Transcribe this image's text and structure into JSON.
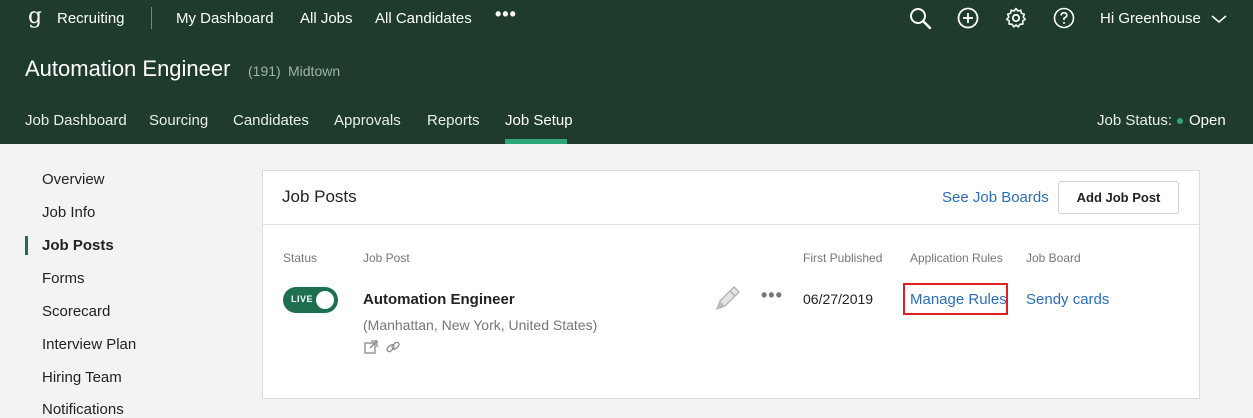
{
  "colors": {
    "header_bg": "#1e3b2c",
    "accent_green": "#2fa67a",
    "link_blue": "#2a6ebb",
    "highlight_red": "#e02020"
  },
  "topnav": {
    "logo_glyph": "g",
    "brand": "Recruiting",
    "links": [
      "My Dashboard",
      "All Jobs",
      "All Candidates"
    ],
    "more_label": "•••",
    "icons": [
      "search-icon",
      "add-circle-icon",
      "gear-icon",
      "help-icon"
    ],
    "user_label": "Hi Greenhouse"
  },
  "job": {
    "title": "Automation Engineer",
    "count": "(191)",
    "location": "Midtown"
  },
  "tabs": [
    "Job Dashboard",
    "Sourcing",
    "Candidates",
    "Approvals",
    "Reports",
    "Job Setup"
  ],
  "active_tab": "Job Setup",
  "job_status": {
    "label": "Job Status:",
    "value": "Open"
  },
  "sidebar": {
    "items": [
      "Overview",
      "Job Info",
      "Job Posts",
      "Forms",
      "Scorecard",
      "Interview Plan",
      "Hiring Team",
      "Notifications"
    ],
    "active": "Job Posts"
  },
  "job_posts": {
    "title": "Job Posts",
    "see_boards": "See Job Boards",
    "add_button": "Add Job Post",
    "columns": [
      "Status",
      "Job Post",
      "First Published",
      "Application Rules",
      "Job Board"
    ],
    "rows": [
      {
        "status": "LIVE",
        "name": "Automation Engineer",
        "location": "(Manhattan, New York, United States)",
        "first_published": "06/27/2019",
        "rules_link": "Manage Rules",
        "board": "Sendy cards"
      }
    ],
    "more_label": "•••"
  }
}
